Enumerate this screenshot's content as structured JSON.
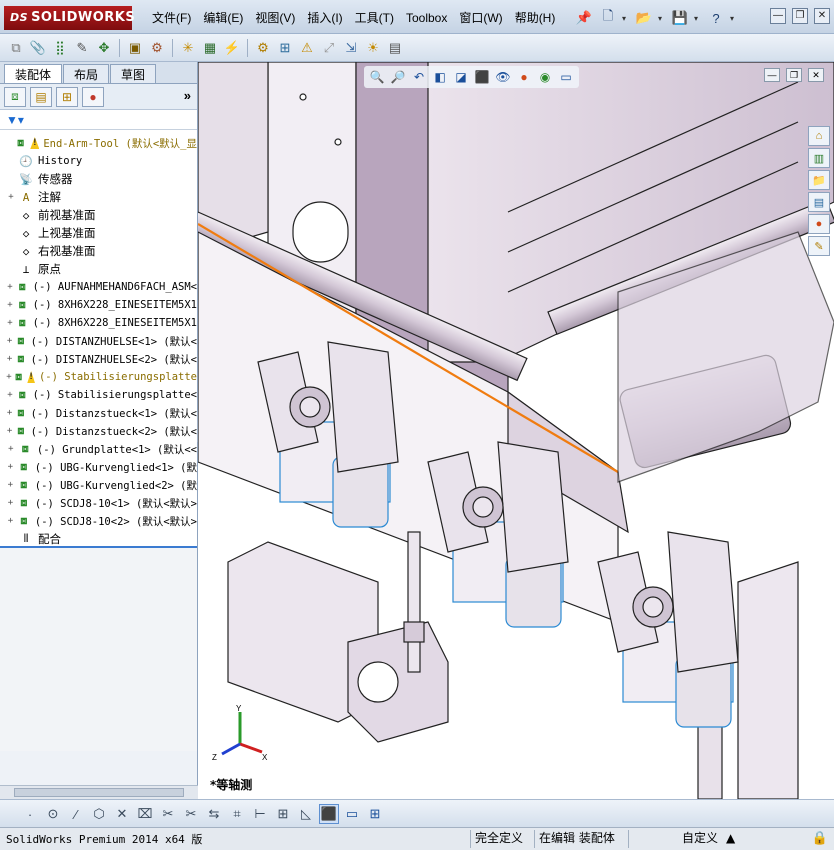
{
  "app": {
    "brand": "SOLIDWORKS",
    "menu": [
      "文件(F)",
      "编辑(E)",
      "视图(V)",
      "插入(I)",
      "工具(T)",
      "Toolbox",
      "窗口(W)",
      "帮助(H)"
    ]
  },
  "left_panel": {
    "tabs": [
      "装配体",
      "布局",
      "草图"
    ],
    "tree": [
      {
        "label": "End-Arm-Tool  (默认<默认_显",
        "icon": "assembly-warning-icon",
        "expand": "",
        "style": "yellow"
      },
      {
        "label": "History",
        "icon": "history-icon",
        "expand": "",
        "style": "normal"
      },
      {
        "label": "传感器",
        "icon": "sensor-icon",
        "expand": "",
        "style": "cn"
      },
      {
        "label": "注解",
        "icon": "annotation-icon",
        "expand": "+",
        "style": "cn"
      },
      {
        "label": "前视基准面",
        "icon": "plane-icon",
        "expand": "",
        "style": "cn"
      },
      {
        "label": "上视基准面",
        "icon": "plane-icon",
        "expand": "",
        "style": "cn"
      },
      {
        "label": "右视基准面",
        "icon": "plane-icon",
        "expand": "",
        "style": "cn"
      },
      {
        "label": "原点",
        "icon": "origin-icon",
        "expand": "",
        "style": "cn"
      },
      {
        "label": "(-) AUFNAHMEHAND6FACH_ASM<",
        "icon": "assembly-icon",
        "expand": "+",
        "style": "normal"
      },
      {
        "label": "(-) 8XH6X228_EINESEITEM5X1",
        "icon": "assembly-icon",
        "expand": "+",
        "style": "normal"
      },
      {
        "label": "(-) 8XH6X228_EINESEITEM5X1",
        "icon": "assembly-icon",
        "expand": "+",
        "style": "normal"
      },
      {
        "label": "(-) DISTANZHUELSE<1> (默认<",
        "icon": "part-icon",
        "expand": "+",
        "style": "normal"
      },
      {
        "label": "(-) DISTANZHUELSE<2> (默认<",
        "icon": "part-icon",
        "expand": "+",
        "style": "normal"
      },
      {
        "label": "(-) Stabilisierungsplatte",
        "icon": "part-warning-icon",
        "expand": "+",
        "style": "yellow"
      },
      {
        "label": "(-) Stabilisierungsplatte<",
        "icon": "part-icon",
        "expand": "+",
        "style": "normal"
      },
      {
        "label": "(-) Distanzstueck<1> (默认<",
        "icon": "part-icon",
        "expand": "+",
        "style": "normal"
      },
      {
        "label": "(-) Distanzstueck<2> (默认<",
        "icon": "part-icon",
        "expand": "+",
        "style": "normal"
      },
      {
        "label": "(-) Grundplatte<1> (默认<<",
        "icon": "part-icon",
        "expand": "+",
        "style": "normal"
      },
      {
        "label": "(-) UBG-Kurvenglied<1> (默",
        "icon": "part-icon",
        "expand": "+",
        "style": "normal"
      },
      {
        "label": "(-) UBG-Kurvenglied<2> (默",
        "icon": "part-icon",
        "expand": "+",
        "style": "normal"
      },
      {
        "label": "(-) SCDJ8-10<1> (默认<默认>",
        "icon": "part-icon",
        "expand": "+",
        "style": "normal"
      },
      {
        "label": "(-) SCDJ8-10<2> (默认<默认>",
        "icon": "part-icon",
        "expand": "+",
        "style": "normal"
      },
      {
        "label": "配合",
        "icon": "mates-icon",
        "expand": "",
        "style": "cn"
      }
    ]
  },
  "viewport": {
    "view_name": "*等轴测",
    "triad": {
      "x": "X",
      "y": "Y",
      "z": "Z"
    }
  },
  "status": {
    "app_version": "SolidWorks Premium 2014 x64 版",
    "definition": "完全定义",
    "mode": "在编辑 装配体",
    "units": "自定义",
    "units_arrow": "▲"
  }
}
